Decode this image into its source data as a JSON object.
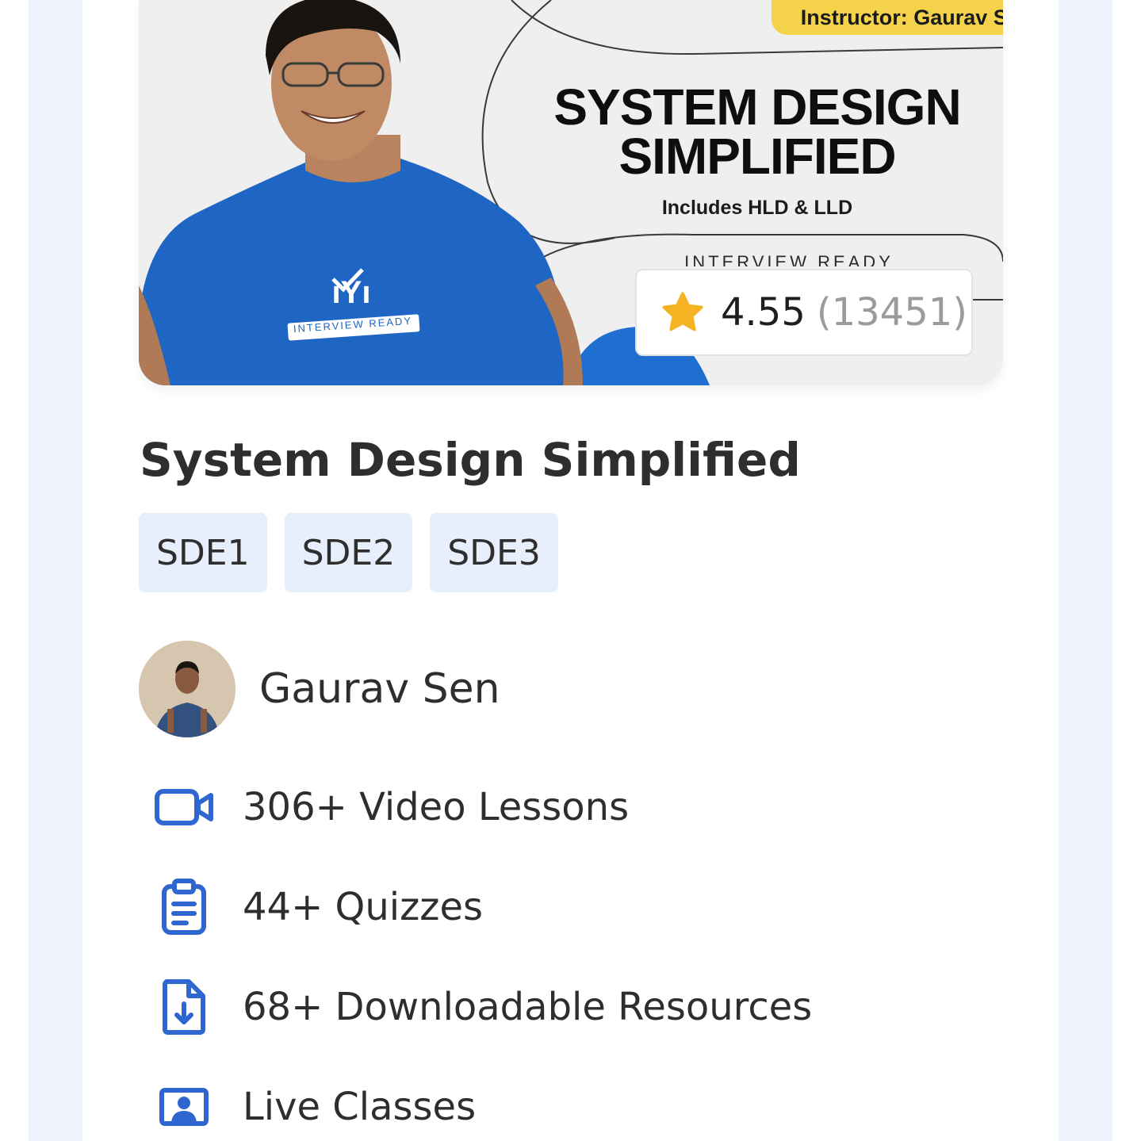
{
  "banner": {
    "instructor_label": "Instructor: Gaurav Sen",
    "title_line1": "SYSTEM DESIGN",
    "title_line2": "SIMPLIFIED",
    "subtitle": "Includes HLD & LLD",
    "brand": "INTERVIEW READY",
    "shirt_text": "INTERVIEW READY"
  },
  "rating": {
    "value": "4.55",
    "count": "(13451)",
    "star_color": "#f5b323"
  },
  "course": {
    "title": "System Design Simplified",
    "tags": [
      "SDE1",
      "SDE2",
      "SDE3"
    ]
  },
  "instructor": {
    "name": "Gaurav Sen"
  },
  "features": [
    {
      "icon": "video-camera-icon",
      "label": "306+ Video Lessons"
    },
    {
      "icon": "clipboard-icon",
      "label": "44+ Quizzes"
    },
    {
      "icon": "download-file-icon",
      "label": "68+ Downloadable Resources"
    },
    {
      "icon": "live-class-icon",
      "label": "Live Classes"
    }
  ],
  "colors": {
    "accent": "#2f66d0",
    "tag_bg": "#e7eefc",
    "side_bg": "#edf2fc",
    "banner_blue": "#1f6fd0"
  }
}
